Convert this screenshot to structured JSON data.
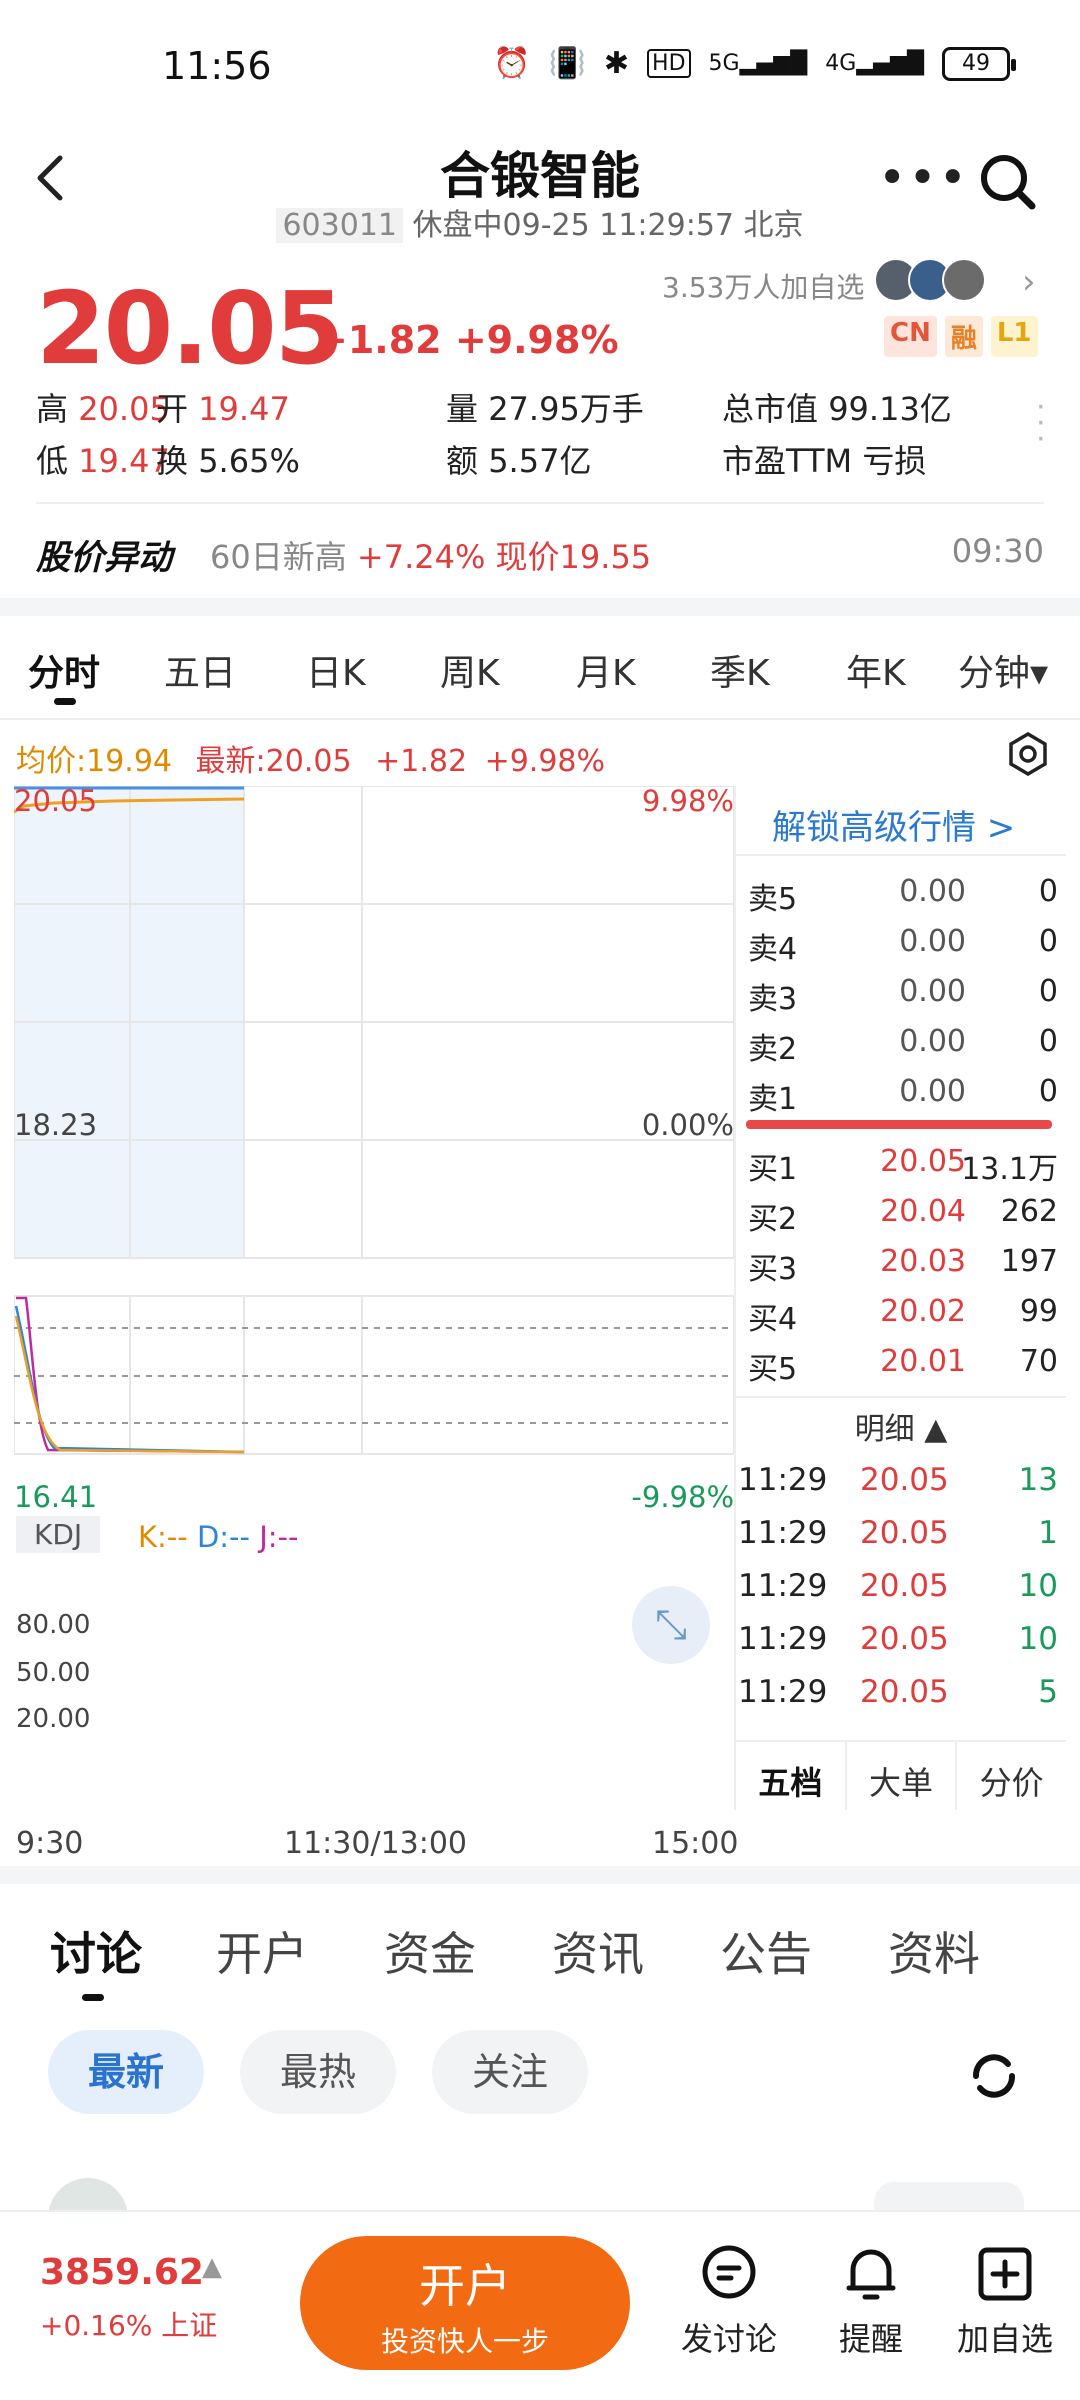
{
  "status_bar": {
    "time": "11:56",
    "battery": "49",
    "net1": "5G",
    "net2": "4G",
    "hd": "HD"
  },
  "header": {
    "title": "合锻智能",
    "code": "603011",
    "status": "休盘中09-25 11:29:57 北京"
  },
  "quote": {
    "price": "20.05",
    "change": "+1.82",
    "change_pct": "+9.98%",
    "followers": "3.53万人加自选",
    "badges": [
      "CN",
      "融",
      "L1"
    ],
    "stats": {
      "high_label": "高",
      "high": "20.05",
      "open_label": "开",
      "open": "19.47",
      "volume_label": "量",
      "volume": "27.95万手",
      "mktcap_label": "总市值",
      "mktcap": "99.13亿",
      "low_label": "低",
      "low": "19.47",
      "turnover_label": "换",
      "turnover": "5.65%",
      "amount_label": "额",
      "amount": "5.57亿",
      "pe_label": "市盈TTM",
      "pe": "亏损"
    }
  },
  "abnormal": {
    "title": "股价异动",
    "text": "60日新高",
    "value": "+7.24% 现价19.55",
    "time": "09:30"
  },
  "chart_tabs": [
    "分时",
    "五日",
    "日K",
    "周K",
    "月K",
    "季K",
    "年K",
    "分钟▾"
  ],
  "chart_info": {
    "avg": "均价:19.94",
    "latest": "最新:20.05",
    "change": "+1.82",
    "pct": "+9.98%"
  },
  "chart_labels": {
    "y_top": "20.05",
    "y_mid": "18.23",
    "y_bot": "16.41",
    "p_top": "9.98%",
    "p_mid": "0.00%",
    "p_bot": "-9.98%",
    "x": [
      "9:30",
      "11:30/13:00",
      "15:00"
    ]
  },
  "kdj": {
    "label": "KDJ",
    "k": "K:--",
    "d": "D:--",
    "j": "J:--",
    "levels": [
      "80.00",
      "50.00",
      "20.00"
    ]
  },
  "order_book": {
    "unlock": "解锁高级行情 >",
    "sell": [
      {
        "label": "卖5",
        "price": "0.00",
        "vol": "0"
      },
      {
        "label": "卖4",
        "price": "0.00",
        "vol": "0"
      },
      {
        "label": "卖3",
        "price": "0.00",
        "vol": "0"
      },
      {
        "label": "卖2",
        "price": "0.00",
        "vol": "0"
      },
      {
        "label": "卖1",
        "price": "0.00",
        "vol": "0"
      }
    ],
    "buy": [
      {
        "label": "买1",
        "price": "20.05",
        "vol": "13.1万"
      },
      {
        "label": "买2",
        "price": "20.04",
        "vol": "262"
      },
      {
        "label": "买3",
        "price": "20.03",
        "vol": "197"
      },
      {
        "label": "买4",
        "price": "20.02",
        "vol": "99"
      },
      {
        "label": "买5",
        "price": "20.01",
        "vol": "70"
      }
    ],
    "detail_title": "明细 ▲",
    "details": [
      {
        "time": "11:29",
        "price": "20.05",
        "vol": "13"
      },
      {
        "time": "11:29",
        "price": "20.05",
        "vol": "1"
      },
      {
        "time": "11:29",
        "price": "20.05",
        "vol": "10"
      },
      {
        "time": "11:29",
        "price": "20.05",
        "vol": "10"
      },
      {
        "time": "11:29",
        "price": "20.05",
        "vol": "5"
      }
    ],
    "tabs": [
      "五档",
      "大单",
      "分价"
    ]
  },
  "discussion_tabs": [
    "讨论",
    "开户",
    "资金",
    "资讯",
    "公告",
    "资料"
  ],
  "filters": [
    "最新",
    "最热",
    "关注"
  ],
  "bottom": {
    "index_value": "3859.62",
    "index_sub": "+0.16% 上证",
    "open_main": "开户",
    "open_sub": "投资快人一步",
    "actions": [
      "发讨论",
      "提醒",
      "加自选"
    ]
  },
  "colors": {
    "up": "#e03c3c",
    "down": "#1a9a5a",
    "accent": "#f26a12",
    "link": "#2a7ad0"
  }
}
